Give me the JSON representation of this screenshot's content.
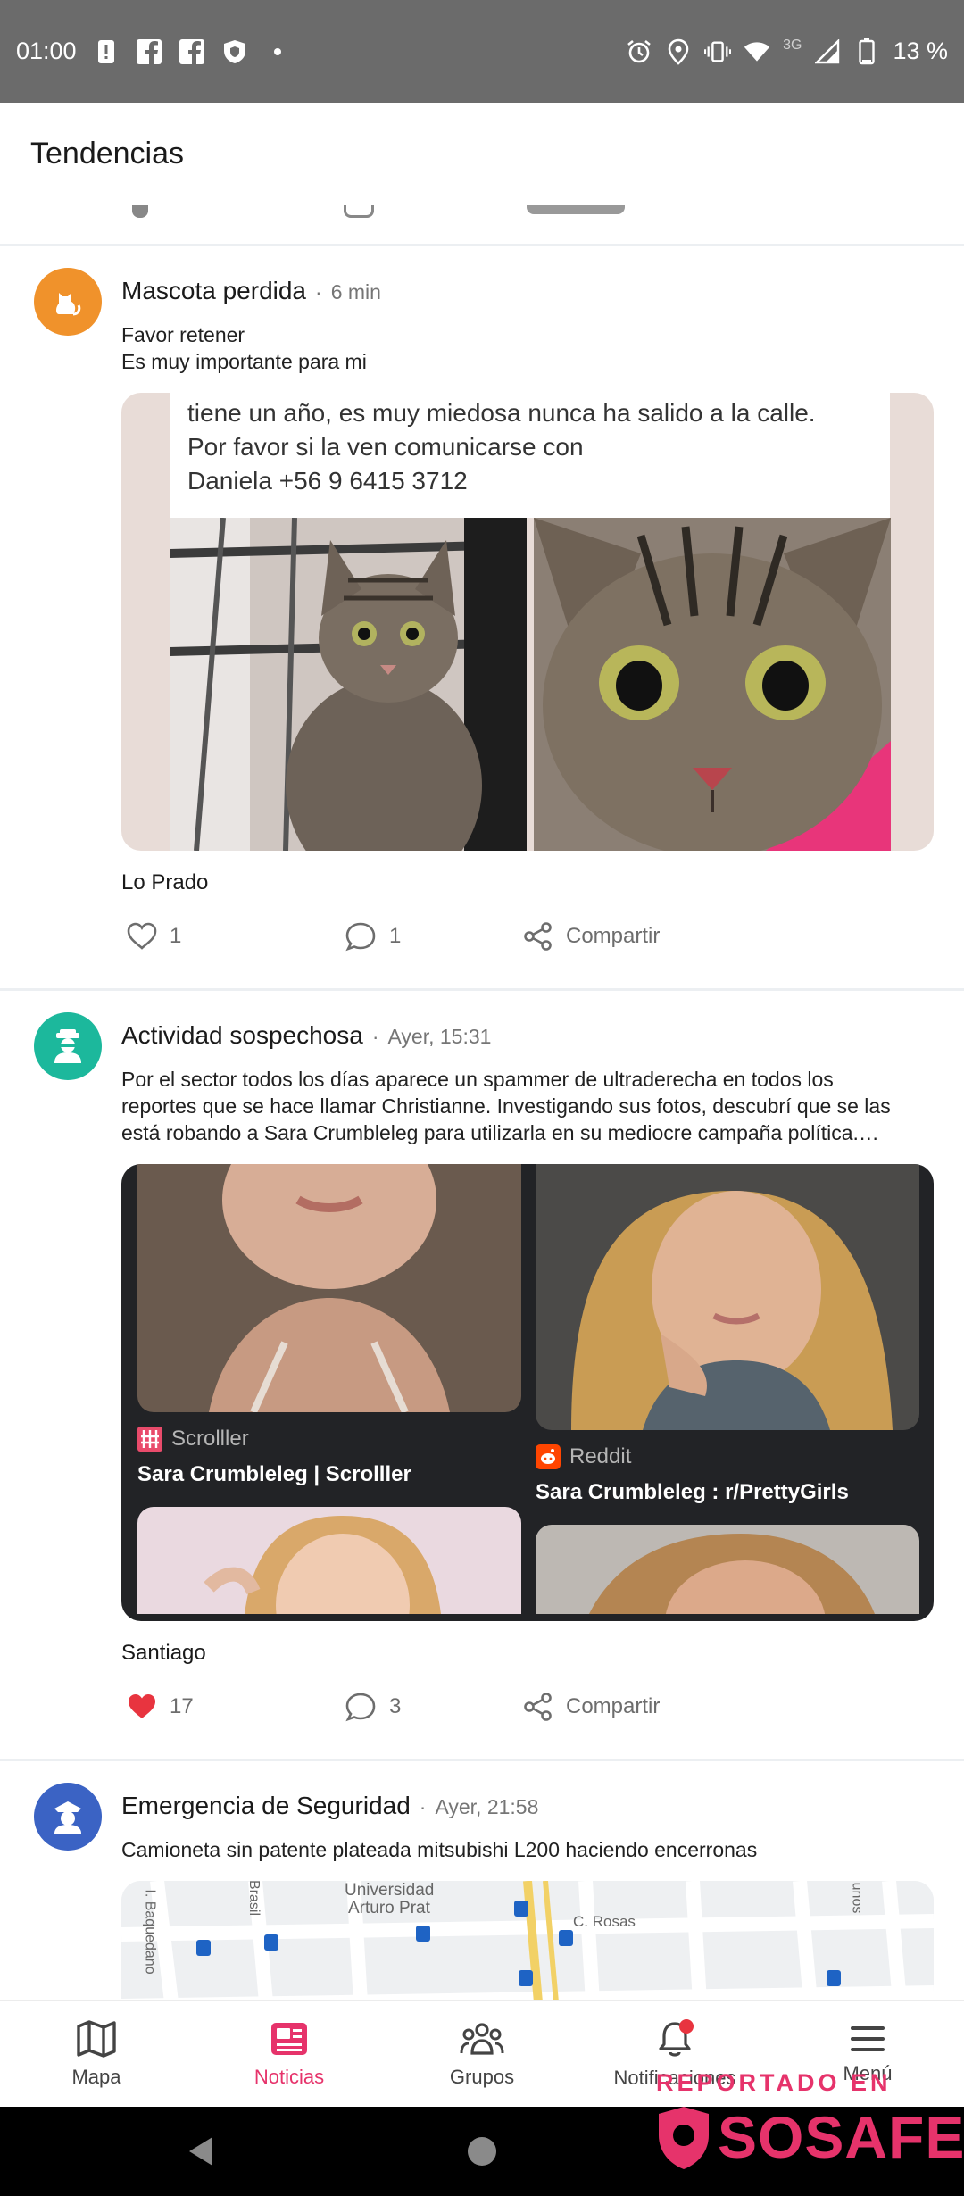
{
  "status_bar": {
    "time": "01:00",
    "network": "3G",
    "battery": "13 %"
  },
  "header": {
    "title": "Tendencias"
  },
  "posts": [
    {
      "avatar_icon": "cat-icon",
      "avatar_color": "#f0922b",
      "title": "Mascota perdida",
      "time": "6 min",
      "text_lines": [
        "Favor retener",
        "Es muy importante para mi"
      ],
      "image_caption_lines": [
        "tiene un año, es muy miedosa nunca ha salido a la calle.",
        "Por favor si la ven comunicarse con",
        "Daniela +56 9 6415 3712"
      ],
      "location": "Lo Prado",
      "likes": "1",
      "comments": "1",
      "share_label": "Compartir",
      "liked": false
    },
    {
      "avatar_icon": "detective-icon",
      "avatar_color": "#1cb89c",
      "title": "Actividad sospechosa",
      "time": "Ayer, 15:31",
      "text": "Por el sector todos los días aparece un spammer de ultraderecha en todos los reportes que se hace llamar Christianne. Investigando sus fotos, descubrí que se las está robando a Sara Crumbleleg para utilizarla en su mediocre campaña política.…",
      "gallery": [
        {
          "source": "Scrolller",
          "title": "Sara Crumbleleg | Scrolller"
        },
        {
          "source": "Reddit",
          "title": "Sara Crumbleleg : r/PrettyGirls"
        }
      ],
      "location": "Santiago",
      "likes": "17",
      "comments": "3",
      "share_label": "Compartir",
      "liked": true
    },
    {
      "avatar_icon": "police-officer-icon",
      "avatar_color": "#3b63c4",
      "title": "Emergencia de Seguridad",
      "time": "Ayer, 21:58",
      "text": "Camioneta sin patente plateada mitsubishi L200 haciendo encerronas",
      "map_labels": [
        "Universidad",
        "Arturo Prat",
        "Brasil",
        "C. Rosas",
        "I. Baquedano",
        "unos"
      ]
    }
  ],
  "bottom_nav": [
    {
      "label": "Mapa",
      "icon": "map-icon",
      "active": false
    },
    {
      "label": "Noticias",
      "icon": "news-icon",
      "active": true
    },
    {
      "label": "Grupos",
      "icon": "groups-icon",
      "active": false
    },
    {
      "label": "Notificaciones",
      "icon": "bell-icon",
      "active": false,
      "badge": true
    },
    {
      "label": "Menú",
      "icon": "menu-icon",
      "active": false
    }
  ],
  "watermark": {
    "line1": "REPORTADO EN",
    "brand": "SOSAFE"
  },
  "colors": {
    "accent": "#e6336b",
    "like_red": "#e8343f"
  }
}
